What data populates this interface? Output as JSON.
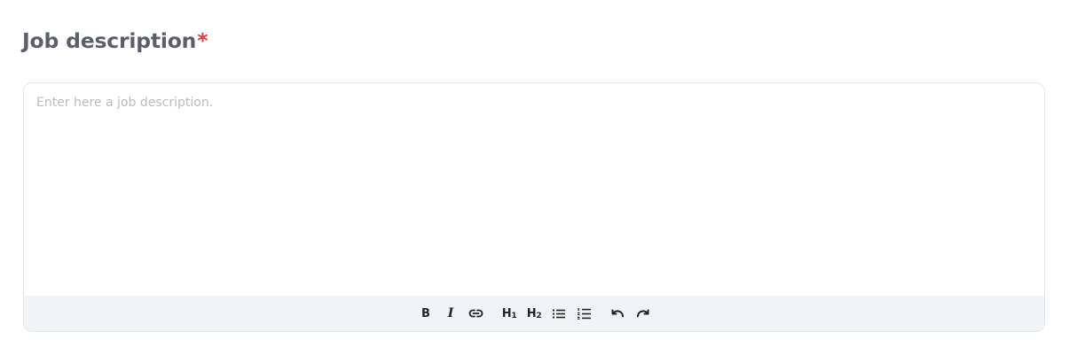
{
  "field": {
    "label": "Job description",
    "required_mark": "*",
    "placeholder": "Enter here a job description.",
    "value": ""
  },
  "toolbar": {
    "bold_label": "B",
    "italic_label": "I",
    "h1_label": "H",
    "h1_level": "1",
    "h2_label": "H",
    "h2_level": "2",
    "icons": {
      "link": "link-icon",
      "bullet_list": "bullet-list-icon",
      "ordered_list": "ordered-list-icon",
      "undo": "undo-icon",
      "redo": "redo-icon"
    }
  },
  "colors": {
    "label": "#5b5f6b",
    "required": "#e23b3b",
    "placeholder": "#b7bbc2",
    "border": "#e5e7eb",
    "toolbar_bg": "#f1f4f7",
    "icon": "#1f2328"
  }
}
